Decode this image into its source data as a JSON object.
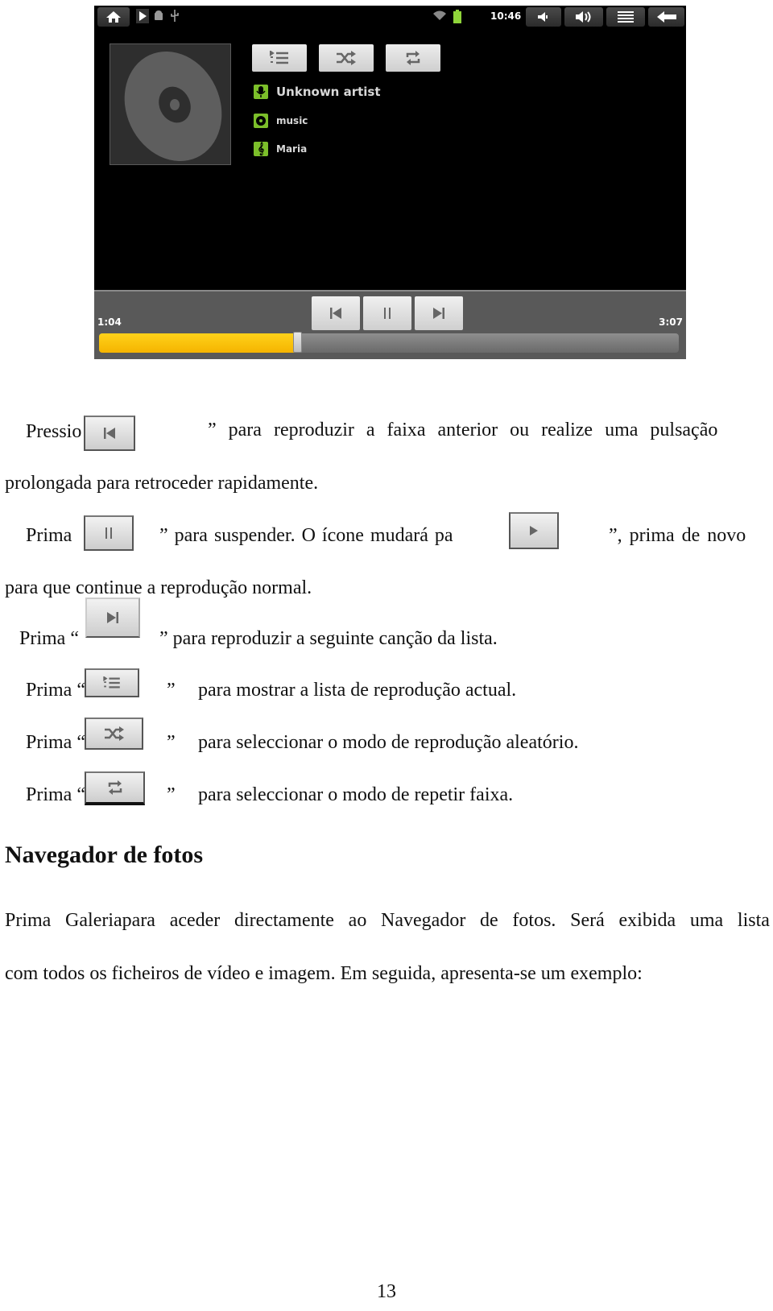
{
  "screenshot": {
    "statusbar": {
      "time": "10:46",
      "icons": [
        "home-icon",
        "play-notification-icon",
        "android-debug-icon",
        "usb-icon",
        "wifi-icon",
        "battery-icon",
        "volume-down-icon",
        "volume-up-icon",
        "menu-icon",
        "back-icon"
      ]
    },
    "toolbar": {
      "playlist_icon": "playlist-icon",
      "shuffle_icon": "shuffle-icon",
      "repeat_icon": "repeat-icon"
    },
    "track": {
      "artist": "Unknown artist",
      "album": "music",
      "title": "Maria"
    },
    "controls": {
      "prev_icon": "previous-icon",
      "pause_icon": "pause-icon",
      "next_icon": "next-icon"
    },
    "progress": {
      "elapsed": "1:04",
      "total": "3:07",
      "fraction": 0.342
    },
    "colors": {
      "accent": "#f5b400",
      "meta_icon": "#7cbf2a"
    }
  },
  "document": {
    "p1": {
      "a": "Pressio",
      "b": "” para reproduzir a faixa anterior ou realize uma pulsação",
      "c": "prolongada para retroceder rapidamente."
    },
    "p2": {
      "a": "Prima",
      "b": "”  para suspender. O ícone mudará pa",
      "c": "”, prima de novo",
      "d": "para que continue a reprodução normal."
    },
    "p3": {
      "a": "Prima “",
      "b": "” para reproduzir a seguinte canção da lista."
    },
    "p4": {
      "a": "Prima “",
      "q": "”",
      "b": "para mostrar a lista de reprodução actual."
    },
    "p5": {
      "a": "Prima “",
      "q": "”",
      "b": "para seleccionar o modo de reprodução aleatório."
    },
    "p6": {
      "a": "Prima “",
      "q": "”",
      "b": "para seleccionar o modo de repetir faixa."
    },
    "heading": "Navegador de fotos",
    "p7": {
      "words": [
        "Prima",
        "Galeriapara",
        "aceder",
        "directamente",
        "ao",
        "Navegador",
        "de",
        "fotos.",
        "Será",
        "exibida",
        "uma",
        "lista"
      ],
      "line2": "com todos os ficheiros de vídeo e imagem. Em seguida, apresenta-se um exemplo:"
    },
    "page_number": "13"
  }
}
